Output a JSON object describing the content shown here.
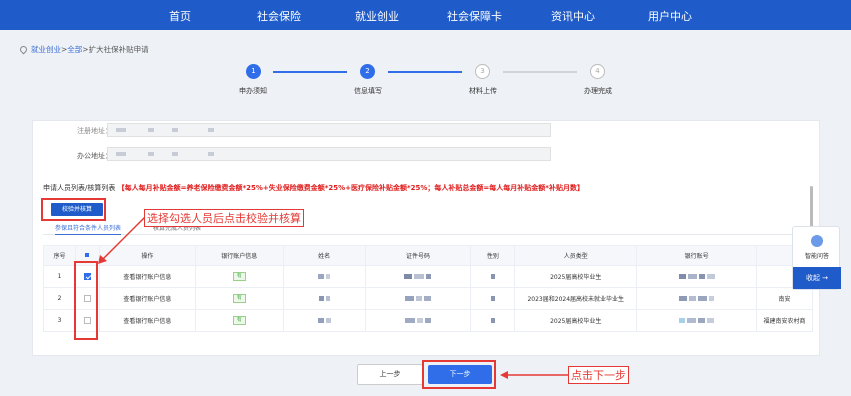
{
  "topnav": {
    "items": [
      "首页",
      "社会保险",
      "就业创业",
      "社会保障卡",
      "资讯中心",
      "用户中心"
    ]
  },
  "breadcrumb": {
    "link1": "就业创业",
    "sep1": ">",
    "link2": "全部",
    "sep2": ">",
    "current": "扩大社保补贴申请"
  },
  "steps": [
    {
      "num": "1",
      "label": "申办须知",
      "state": "done"
    },
    {
      "num": "2",
      "label": "信息填写",
      "state": "active"
    },
    {
      "num": "3",
      "label": "材料上传",
      "state": "todo"
    },
    {
      "num": "4",
      "label": "办理完成",
      "state": "todo"
    }
  ],
  "form": {
    "field1_label": "注册地址：",
    "field2_label": "办公地址："
  },
  "requirement": {
    "prefix": "申请人员列表/核算列表",
    "formula": "【每人每月补贴金额=养老保险缴费金额*25%+失业保险缴费金额*25%+医疗保险补贴金额*25%；每人补贴总金额=每人每月补贴金额*补贴月数】"
  },
  "verify_button": "校验并核算",
  "annotation_top": "选择勾选人员后点击校验并核算",
  "annotation_bottom": "点击下一步",
  "tabs": {
    "active": "参保且符合条件人员列表",
    "inactive": "核算完成人员列表"
  },
  "table": {
    "headers": [
      "序号",
      "",
      "操作",
      "银行账户信息",
      "姓名",
      "证件号码",
      "性别",
      "人员类型",
      "银行账号",
      ""
    ],
    "rows": [
      {
        "index": "1",
        "checked": true,
        "action": "查看银行账户信息",
        "bank_info": "有",
        "person_type": "2025届高校毕业生",
        "extra": ""
      },
      {
        "index": "2",
        "checked": false,
        "action": "查看银行账户信息",
        "bank_info": "有",
        "person_type": "2023届和2024届高校未就业毕业生",
        "extra": "南安"
      },
      {
        "index": "3",
        "checked": false,
        "action": "查看银行账户信息",
        "bank_info": "有",
        "person_type": "2025届高校毕业生",
        "extra": "福建南安农村商"
      }
    ]
  },
  "buttons": {
    "prev": "上一步",
    "next": "下一步"
  },
  "side_widget": {
    "label": "智能问答",
    "collapse": "收起 →"
  },
  "colors": {
    "primary": "#1f5bc9",
    "accent": "#2f6ee8",
    "annotation": "#e53935"
  }
}
